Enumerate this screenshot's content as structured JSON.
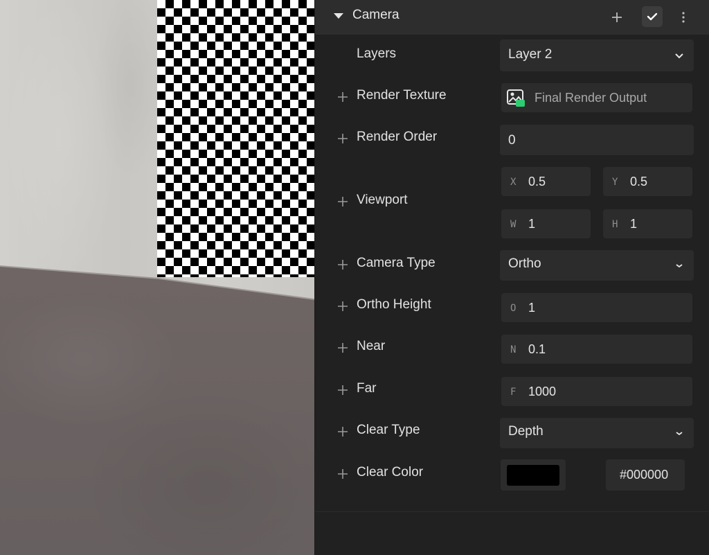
{
  "component": {
    "title": "Camera"
  },
  "header_icons": {
    "collapse": "caret-down-icon",
    "add": "plus-icon",
    "enabled": "checkmark-icon",
    "more": "kebab-menu-icon"
  },
  "rows": {
    "layers": {
      "label": "Layers",
      "value": "Layer 2"
    },
    "render_texture": {
      "label": "Render Texture",
      "value": "Final Render Output",
      "icon": "render-texture-icon"
    },
    "render_order": {
      "label": "Render Order",
      "value": "0"
    },
    "viewport": {
      "label": "Viewport",
      "x_prefix": "X",
      "x": "0.5",
      "y_prefix": "Y",
      "y": "0.5",
      "w_prefix": "W",
      "w": "1",
      "h_prefix": "H",
      "h": "1"
    },
    "camera_type": {
      "label": "Camera Type",
      "value": "Ortho"
    },
    "ortho_height": {
      "label": "Ortho Height",
      "prefix": "O",
      "value": "1"
    },
    "near": {
      "label": "Near",
      "prefix": "N",
      "value": "0.1"
    },
    "far": {
      "label": "Far",
      "prefix": "F",
      "value": "1000"
    },
    "clear_type": {
      "label": "Clear Type",
      "value": "Depth"
    },
    "clear_color": {
      "label": "Clear Color",
      "hex": "#000000",
      "swatch": "#000000"
    }
  },
  "colors": {
    "panel_bg": "#212121",
    "header_bg": "#2d2d2d",
    "field_bg": "#2c2c2c",
    "texture_icon_accent": "#2ecc71"
  }
}
